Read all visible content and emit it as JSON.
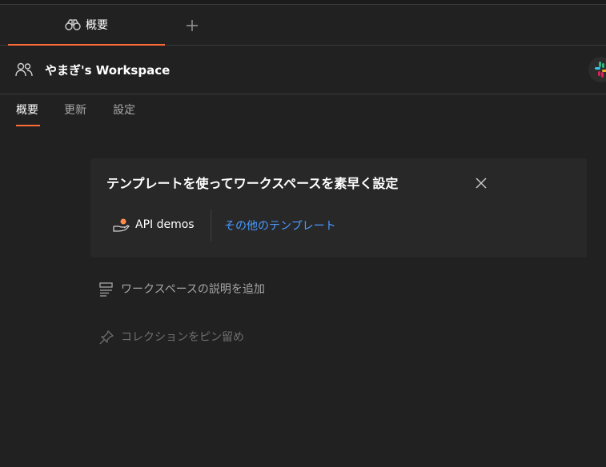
{
  "tabs": {
    "overview_label": "概要",
    "add_icon": "plus-icon",
    "overview_icon": "binoculars-icon"
  },
  "workspace": {
    "name": "やまぎ's Workspace",
    "icon": "people-icon",
    "integration_icon": "slack-icon"
  },
  "subtabs": [
    {
      "label": "概要",
      "active": true
    },
    {
      "label": "更新",
      "active": false
    },
    {
      "label": "設定",
      "active": false
    }
  ],
  "template_card": {
    "title": "テンプレートを使ってワークスペースを素早く設定",
    "templates": [
      {
        "label": "API demos",
        "icon": "hand-orb-icon"
      }
    ],
    "other_link": "その他のテンプレート",
    "close_icon": "close-icon"
  },
  "actions": {
    "add_description": "ワークスペースの説明を追加",
    "pin_collection": "コレクションをピン留め"
  },
  "colors": {
    "background": "#212121",
    "card": "#282828",
    "accent": "#ff6c37",
    "link": "#4a9bff"
  }
}
